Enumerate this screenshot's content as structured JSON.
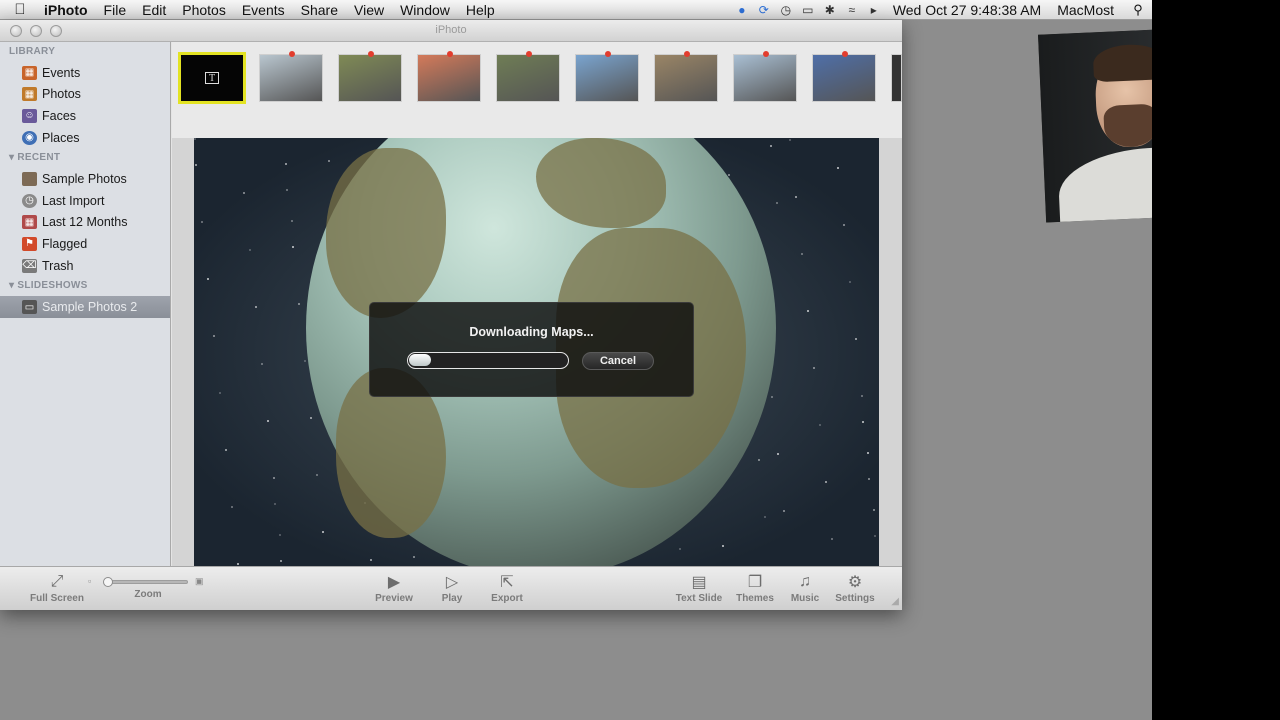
{
  "menubar": {
    "app_name": "iPhoto",
    "items": [
      "File",
      "Edit",
      "Photos",
      "Events",
      "Share",
      "View",
      "Window",
      "Help"
    ],
    "clock": "Wed Oct 27  9:48:38 AM",
    "user": "MacMost"
  },
  "window": {
    "title": "iPhoto"
  },
  "sidebar": {
    "sections": [
      {
        "header": "LIBRARY",
        "items": [
          {
            "label": "Events",
            "icon": "events-icon",
            "color": "#c8642a"
          },
          {
            "label": "Photos",
            "icon": "photos-icon",
            "color": "#c07a2a"
          },
          {
            "label": "Faces",
            "icon": "faces-icon",
            "color": "#6a5a9a"
          },
          {
            "label": "Places",
            "icon": "places-icon",
            "color": "#3f6fb5"
          }
        ]
      },
      {
        "header": "RECENT",
        "items": [
          {
            "label": "Sample Photos",
            "icon": "event-thumbnail-icon",
            "color": "#7d6a55"
          },
          {
            "label": "Last Import",
            "icon": "clock-icon",
            "color": "#8a8a8a"
          },
          {
            "label": "Last 12 Months",
            "icon": "calendar-icon",
            "color": "#b04a4a"
          },
          {
            "label": "Flagged",
            "icon": "flag-icon",
            "color": "#d24a2a"
          },
          {
            "label": "Trash",
            "icon": "trash-icon",
            "color": "#7a7a7a"
          }
        ]
      },
      {
        "header": "SLIDESHOWS",
        "items": [
          {
            "label": "Sample Photos 2",
            "icon": "slideshow-icon",
            "color": "#555555",
            "selected": true
          }
        ]
      }
    ]
  },
  "filmstrip": {
    "title_slide_glyph": "T",
    "thumbnails": [
      {
        "name": "thumb-snow",
        "color": "#b9c6cf"
      },
      {
        "name": "thumb-elk",
        "color": "#7f8a55"
      },
      {
        "name": "thumb-flamingos",
        "color": "#d47a5a"
      },
      {
        "name": "thumb-trees",
        "color": "#6f7d55"
      },
      {
        "name": "thumb-house",
        "color": "#7aa4cf"
      },
      {
        "name": "thumb-street",
        "color": "#9a8566"
      },
      {
        "name": "thumb-boat",
        "color": "#a9bfd3"
      },
      {
        "name": "thumb-person",
        "color": "#4f6fa8"
      }
    ]
  },
  "dialog": {
    "message": "Downloading Maps...",
    "progress": 0.14,
    "cancel_label": "Cancel"
  },
  "toolbar": {
    "full_screen": "Full Screen",
    "zoom": "Zoom",
    "preview": "Preview",
    "play": "Play",
    "export": "Export",
    "text_slide": "Text Slide",
    "themes": "Themes",
    "music": "Music",
    "settings": "Settings"
  }
}
